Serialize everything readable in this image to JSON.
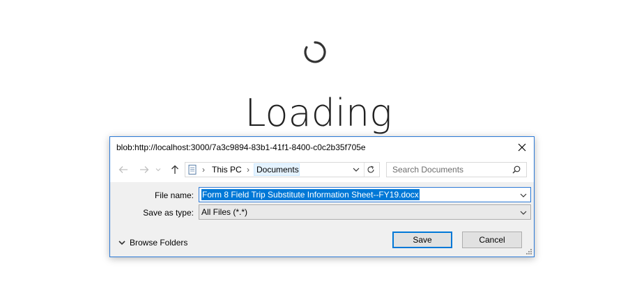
{
  "background": {
    "loading_text": "Loading"
  },
  "dialog": {
    "title": "blob:http://localhost:3000/7a3c9894-83b1-41f1-8400-c0c2b35f705e",
    "nav": {
      "back_icon": "arrow-left-icon",
      "forward_icon": "arrow-right-icon",
      "recent_icon": "chevron-down-icon",
      "up_icon": "arrow-up-icon"
    },
    "address": {
      "crumbs": [
        "This PC",
        "Documents"
      ],
      "refresh_icon": "refresh-icon"
    },
    "search": {
      "placeholder": "Search Documents"
    },
    "file_name": {
      "label": "File name:",
      "value": "Form 8 Field Trip Substitute Information Sheet--FY19.docx"
    },
    "save_as_type": {
      "label": "Save as type:",
      "value": "All Files (*.*)"
    },
    "browse_folders_label": "Browse Folders",
    "buttons": {
      "save": "Save",
      "cancel": "Cancel"
    }
  },
  "colors": {
    "accent": "#0078d7",
    "dialog_border": "#2b79d6",
    "dialog_bg": "#f0f0f0"
  }
}
